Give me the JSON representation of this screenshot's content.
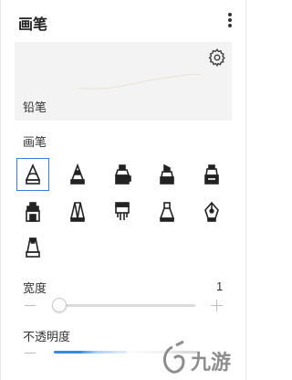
{
  "header": {
    "title": "画笔",
    "more_icon": "more-vertical-icon"
  },
  "preview": {
    "label": "铅笔",
    "settings_icon": "gear-icon"
  },
  "brushes": {
    "section_label": "画笔",
    "items": [
      {
        "icon": "pencil-brush-icon",
        "selected": true
      },
      {
        "icon": "cone-brush-icon",
        "selected": false
      },
      {
        "icon": "marker-brush-icon",
        "selected": false
      },
      {
        "icon": "chisel-marker-brush-icon",
        "selected": false
      },
      {
        "icon": "wide-marker-brush-icon",
        "selected": false
      },
      {
        "icon": "ink-bottle-brush-icon",
        "selected": false
      },
      {
        "icon": "calligraphy-brush-icon",
        "selected": false
      },
      {
        "icon": "paint-brush-icon",
        "selected": false
      },
      {
        "icon": "flat-brush-icon",
        "selected": false
      },
      {
        "icon": "fountain-pen-brush-icon",
        "selected": false
      },
      {
        "icon": "crayon-brush-icon",
        "selected": false
      }
    ]
  },
  "width": {
    "label": "宽度",
    "value": "1",
    "fraction": 0.0
  },
  "opacity": {
    "label": "不透明度",
    "fraction": 0.5
  },
  "watermark": {
    "text": "九游"
  },
  "colors": {
    "accent": "#3a7be0",
    "slider_fill": "#2f8de4"
  }
}
